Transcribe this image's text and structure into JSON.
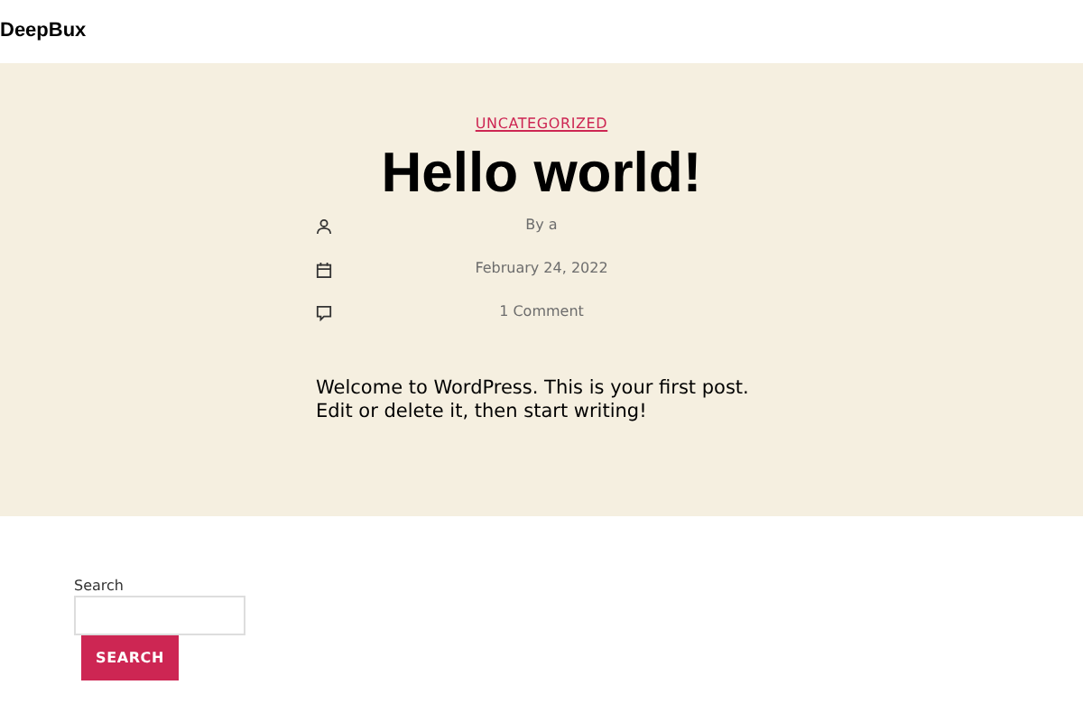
{
  "site_title": "DeepBux",
  "post": {
    "category": "UNCATEGORIZED",
    "title": "Hello world!",
    "meta": [
      {
        "kind": "author",
        "text": "By a"
      },
      {
        "kind": "date",
        "text": "February 24, 2022"
      },
      {
        "kind": "comments",
        "text": "1 Comment"
      }
    ],
    "body": "Welcome to WordPress. This is your first post. Edit or delete it, then start writing!"
  },
  "search": {
    "label": "Search",
    "button": "SEARCH"
  }
}
